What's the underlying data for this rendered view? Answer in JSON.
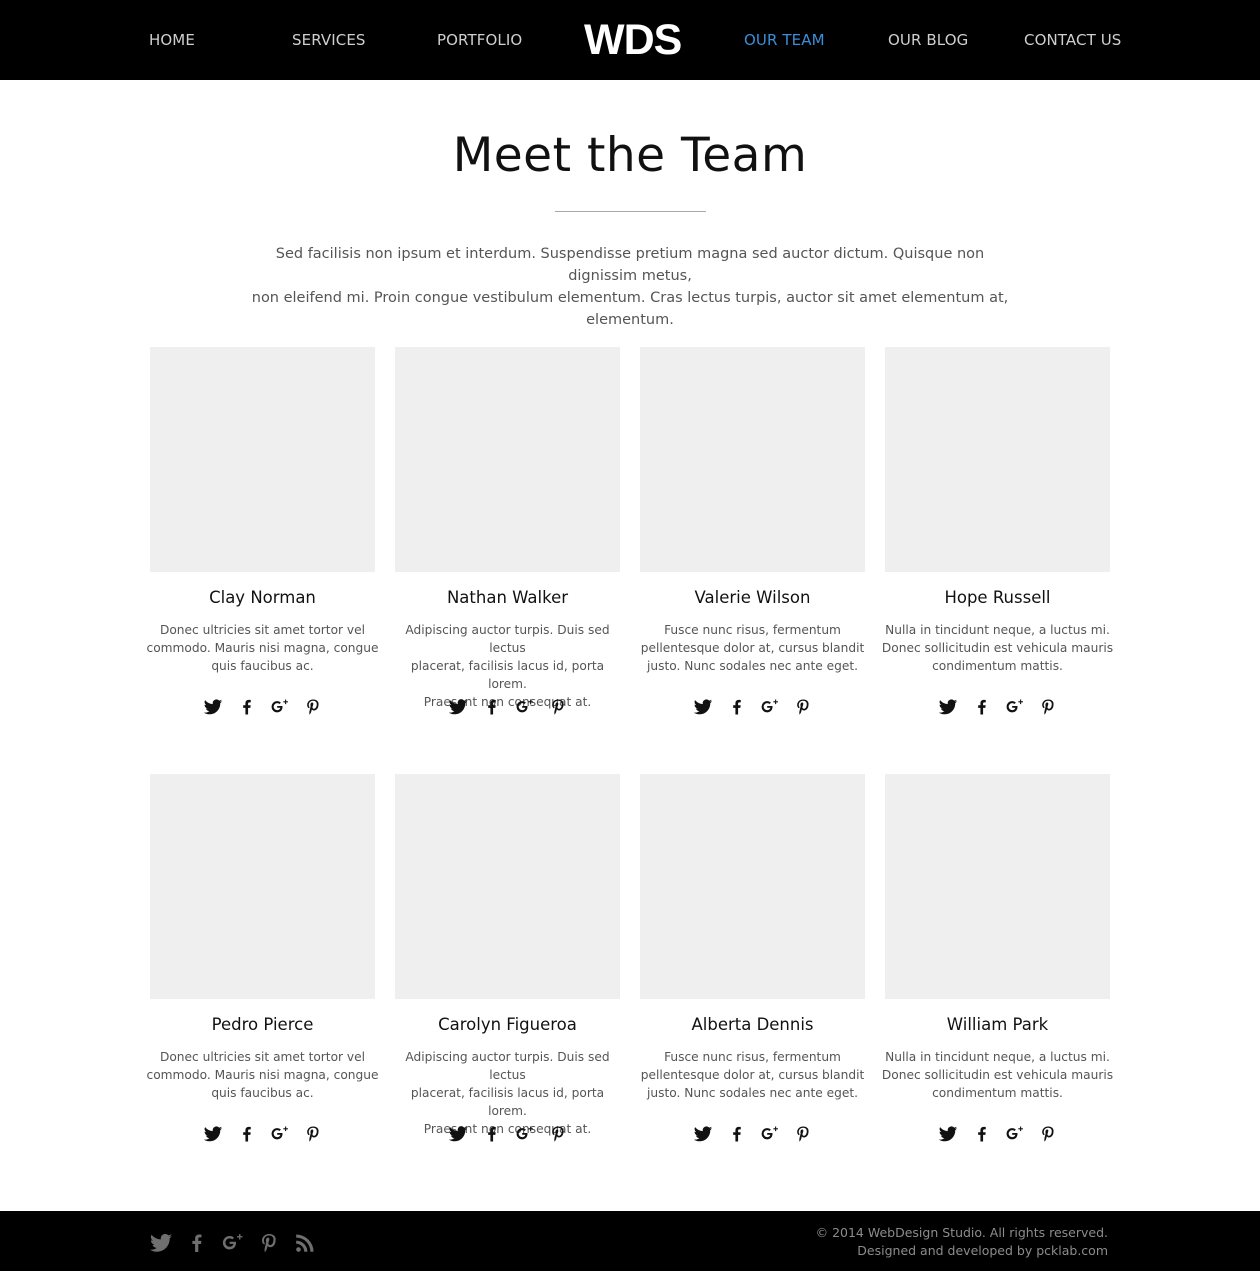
{
  "nav": {
    "items": [
      {
        "label": "HOME",
        "active": false
      },
      {
        "label": "SERVICES",
        "active": false
      },
      {
        "label": "PORTFOLIO",
        "active": false
      },
      {
        "label": "OUR TEAM",
        "active": true
      },
      {
        "label": "OUR BLOG",
        "active": false
      },
      {
        "label": "CONTACT US",
        "active": false
      }
    ],
    "logo": "WDS",
    "active_color": "#3a8fd9"
  },
  "hero": {
    "title": "Meet the Team",
    "intro_line1": "Sed facilisis non ipsum et interdum. Suspendisse pretium magna sed auctor dictum. Quisque non dignissim metus,",
    "intro_line2": "non eleifend mi. Proin congue vestibulum elementum. Cras lectus turpis, auctor sit amet elementum at, elementum."
  },
  "team": [
    {
      "name": "Clay Norman",
      "bio": [
        "Donec ultricies sit amet tortor vel",
        "commodo. Mauris nisi magna, congue",
        "quis faucibus ac."
      ]
    },
    {
      "name": "Nathan Walker",
      "bio": [
        "Adipiscing auctor turpis. Duis sed lectus",
        "placerat, facilisis lacus id, porta lorem.",
        "Praesent non consequat at."
      ]
    },
    {
      "name": "Valerie Wilson",
      "bio": [
        "Fusce nunc risus, fermentum",
        "pellentesque dolor at, cursus blandit",
        "justo. Nunc sodales nec ante eget."
      ]
    },
    {
      "name": "Hope Russell",
      "bio": [
        "Nulla in tincidunt neque, a luctus mi.",
        "Donec sollicitudin est vehicula mauris",
        "condimentum mattis."
      ]
    },
    {
      "name": "Pedro Pierce",
      "bio": [
        "Donec ultricies sit amet tortor vel",
        "commodo. Mauris nisi magna, congue",
        "quis faucibus ac."
      ]
    },
    {
      "name": "Carolyn Figueroa",
      "bio": [
        "Adipiscing auctor turpis. Duis sed lectus",
        "placerat, facilisis lacus id, porta lorem.",
        "Praesent non consequat at."
      ]
    },
    {
      "name": "Alberta Dennis",
      "bio": [
        "Fusce nunc risus, fermentum",
        "pellentesque dolor at, cursus blandit",
        "justo. Nunc sodales nec ante eget."
      ]
    },
    {
      "name": "William Park",
      "bio": [
        "Nulla in tincidunt neque, a luctus mi.",
        "Donec sollicitudin est vehicula mauris",
        "condimentum mattis."
      ]
    }
  ],
  "member_social_icons": [
    "twitter-icon",
    "facebook-icon",
    "google-plus-icon",
    "pinterest-icon"
  ],
  "footer": {
    "social_icons": [
      "twitter-icon",
      "facebook-icon",
      "google-plus-icon",
      "pinterest-icon",
      "rss-icon"
    ],
    "copyright": "© 2014 WebDesign Studio. All rights reserved.",
    "credits": "Designed and developed by pcklab.com"
  },
  "colors": {
    "header_bg": "#000000",
    "footer_bg": "#000000",
    "photo_placeholder": "#efefef",
    "footer_icon": "#6f6f6f"
  }
}
